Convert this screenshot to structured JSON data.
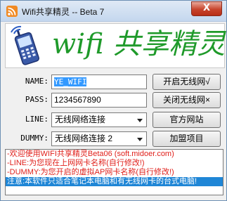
{
  "window": {
    "title": "Wifi共享精灵 -- Beta 7",
    "close_symbol": "X"
  },
  "banner": {
    "text": "wifi 共享精灵",
    "icon": "phone-wifi-icon",
    "color": "#1f9a2a"
  },
  "form": {
    "name_label": "NAME:",
    "name_value": "YE_WIFI",
    "pass_label": "PASS:",
    "pass_value": "1234567890",
    "line_label": "LINE:",
    "line_value": "无线网络连接",
    "dummy_label": "DUMMY:",
    "dummy_value": "无线网络连接 2"
  },
  "buttons": {
    "start": "开启无线网√",
    "stop": "关闭无线网×",
    "website": "官方网站",
    "donate": "加盟项目"
  },
  "info": {
    "line1": "-欢迎使用WIFI共享精灵Beta06 (soft.midoer.com)",
    "line2": "-LINE:为您现在上网网卡名称(自行修改!)",
    "line3": "-DUMMY:为您开启的虚拟AP网卡名称(自行修改!)",
    "line4": "注意:本软件只适合笔记本电脑和有无线网卡的台式电脑!",
    "text_color": "#e0201b",
    "highlight_color": "#1f86d6"
  }
}
